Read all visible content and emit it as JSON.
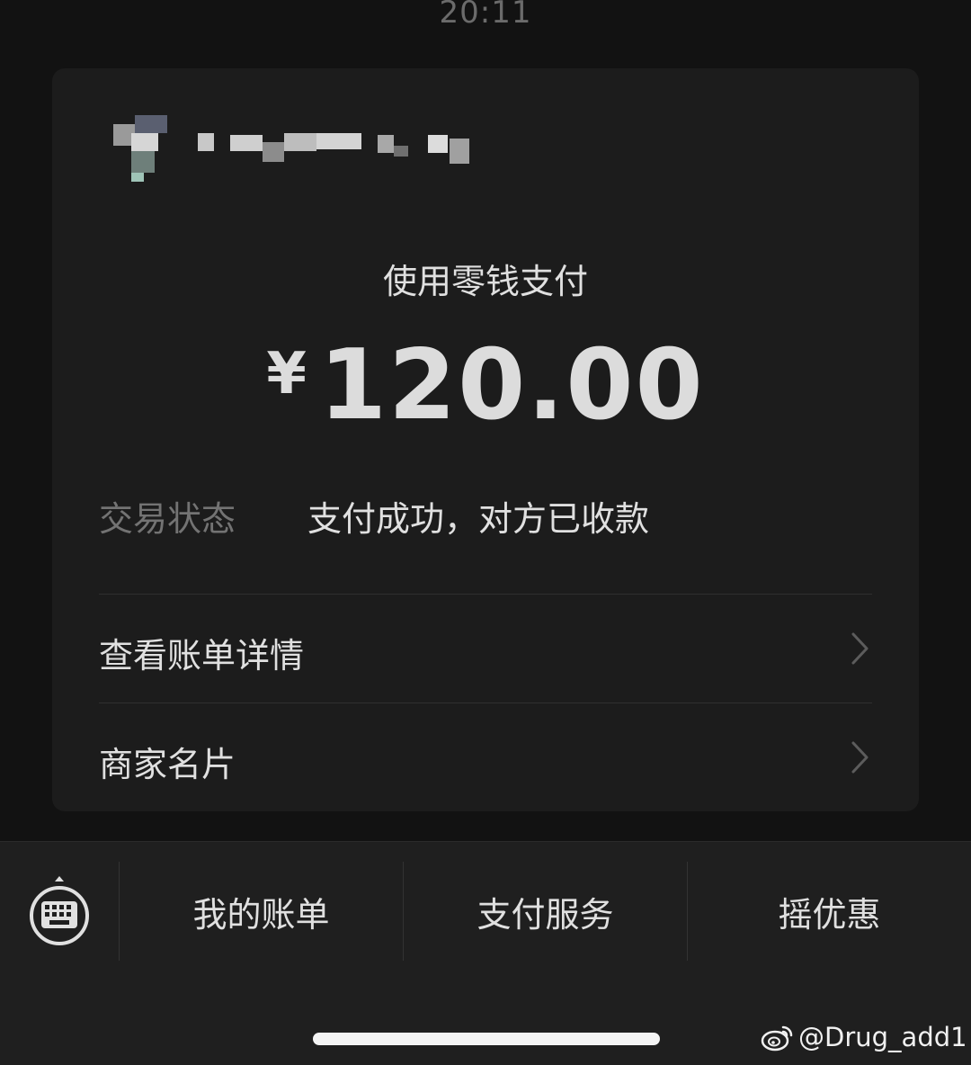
{
  "status_bar": {
    "time": "20:11"
  },
  "payment": {
    "method": "使用零钱支付",
    "currency_symbol": "¥",
    "amount": "120.00",
    "status_label": "交易状态",
    "status_value": "支付成功，对方已收款"
  },
  "links": [
    {
      "label": "查看账单详情",
      "icon": "chevron-right-icon"
    },
    {
      "label": "商家名片",
      "icon": "chevron-right-icon"
    }
  ],
  "bottom_menu": {
    "keyboard_icon": "keyboard-icon",
    "items": [
      {
        "label": "我的账单"
      },
      {
        "label": "支付服务"
      },
      {
        "label": "摇优惠"
      }
    ]
  },
  "watermark": {
    "icon": "weibo-icon",
    "text": "@Drug_add1"
  },
  "colors": {
    "background": "#121212",
    "card": "#1c1c1c",
    "bottom_bar": "#1f1f1f",
    "primary_text": "#e0e0e0",
    "secondary_text": "#737373"
  }
}
